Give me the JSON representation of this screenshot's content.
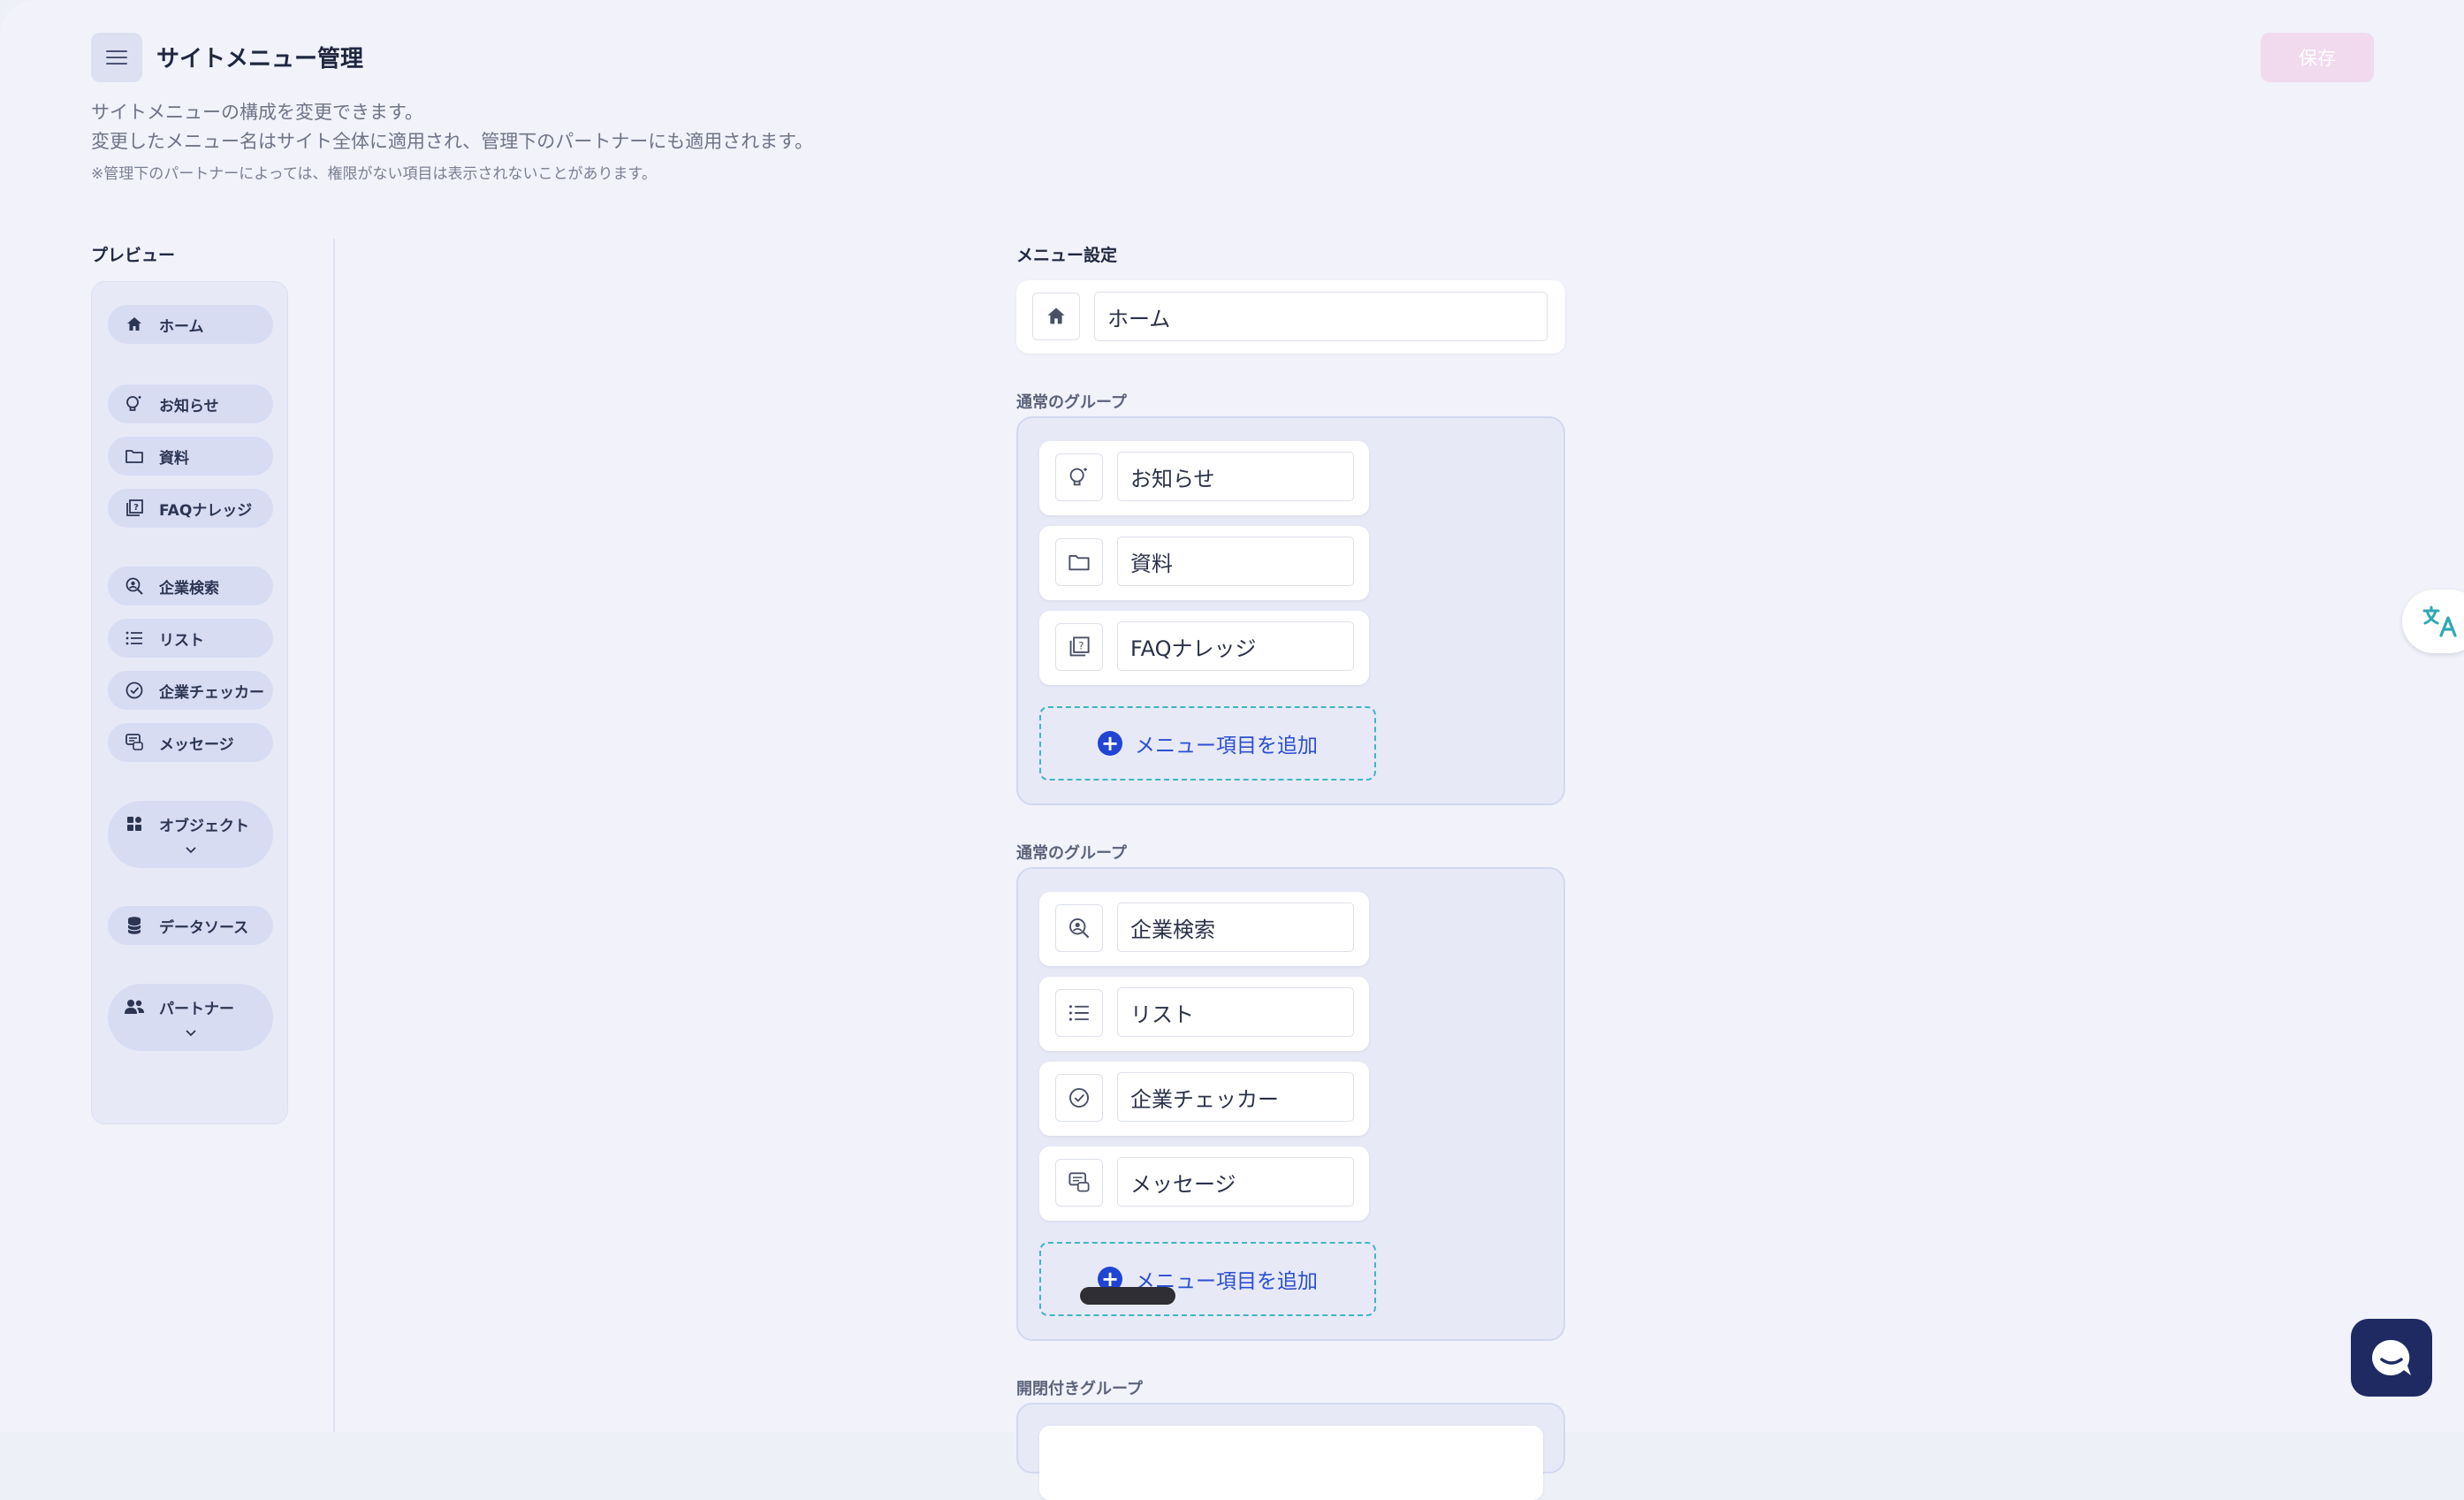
{
  "header": {
    "title": "サイトメニュー管理",
    "description_line1": "サイトメニューの構成を変更できます。",
    "description_line2": "変更したメニュー名はサイト全体に適用され、管理下のパートナーにも適用されます。",
    "note": "※管理下のパートナーによっては、権限がない項目は表示されないことがあります。",
    "save_label": "保存"
  },
  "preview": {
    "label": "プレビュー",
    "items": [
      {
        "label": "ホーム",
        "icon": "home-icon"
      },
      {
        "label": "お知らせ",
        "icon": "bulb-icon"
      },
      {
        "label": "資料",
        "icon": "folder-icon"
      },
      {
        "label": "FAQナレッジ",
        "icon": "faq-icon"
      },
      {
        "label": "企業検索",
        "icon": "company-search-icon"
      },
      {
        "label": "リスト",
        "icon": "list-icon"
      },
      {
        "label": "企業チェッカー",
        "icon": "check-circle-icon"
      },
      {
        "label": "メッセージ",
        "icon": "message-icon"
      },
      {
        "label": "オブジェクト",
        "icon": "grid-icon",
        "expandable": true
      },
      {
        "label": "データソース",
        "icon": "database-icon"
      },
      {
        "label": "パートナー",
        "icon": "people-icon",
        "expandable": true
      }
    ]
  },
  "settings": {
    "label": "メニュー設定",
    "home": {
      "value": "ホーム",
      "icon": "home-icon"
    },
    "groups": [
      {
        "label": "通常のグループ",
        "items": [
          {
            "value": "お知らせ",
            "icon": "bulb-icon"
          },
          {
            "value": "資料",
            "icon": "folder-icon"
          },
          {
            "value": "FAQナレッジ",
            "icon": "faq-icon"
          }
        ],
        "add_label": "メニュー項目を追加"
      },
      {
        "label": "通常のグループ",
        "items": [
          {
            "value": "企業検索",
            "icon": "company-search-icon"
          },
          {
            "value": "リスト",
            "icon": "list-icon"
          },
          {
            "value": "企業チェッカー",
            "icon": "check-circle-icon"
          },
          {
            "value": "メッセージ",
            "icon": "message-icon"
          }
        ],
        "add_label": "メニュー項目を追加"
      },
      {
        "label": "開閉付きグループ",
        "items": [],
        "add_label": ""
      }
    ]
  },
  "colors": {
    "accent": "#2145d3",
    "dashed_border": "#3fb6c3",
    "save_disabled": "#f1d9ee",
    "chat_fab": "#1f2a63"
  }
}
